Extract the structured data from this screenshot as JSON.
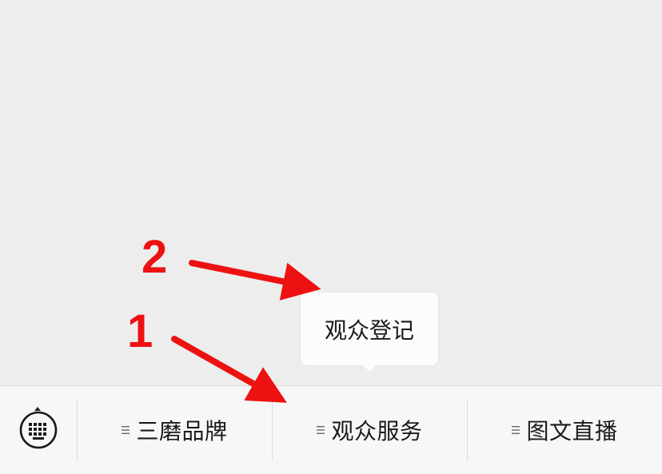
{
  "menu": {
    "items": [
      {
        "label": "三磨品牌",
        "icon": "menu-lines-icon"
      },
      {
        "label": "观众服务",
        "icon": "menu-lines-icon"
      },
      {
        "label": "图文直播",
        "icon": "menu-lines-icon"
      }
    ],
    "keyboard_icon": "keyboard-icon"
  },
  "submenu": {
    "items": [
      {
        "label": "观众登记"
      }
    ]
  },
  "annotations": {
    "labels": [
      "1",
      "2"
    ],
    "color": "#ee1111"
  },
  "colors": {
    "chat_background": "#ededed",
    "menu_background": "#f7f7f7",
    "popup_background": "#fcfcfc"
  }
}
